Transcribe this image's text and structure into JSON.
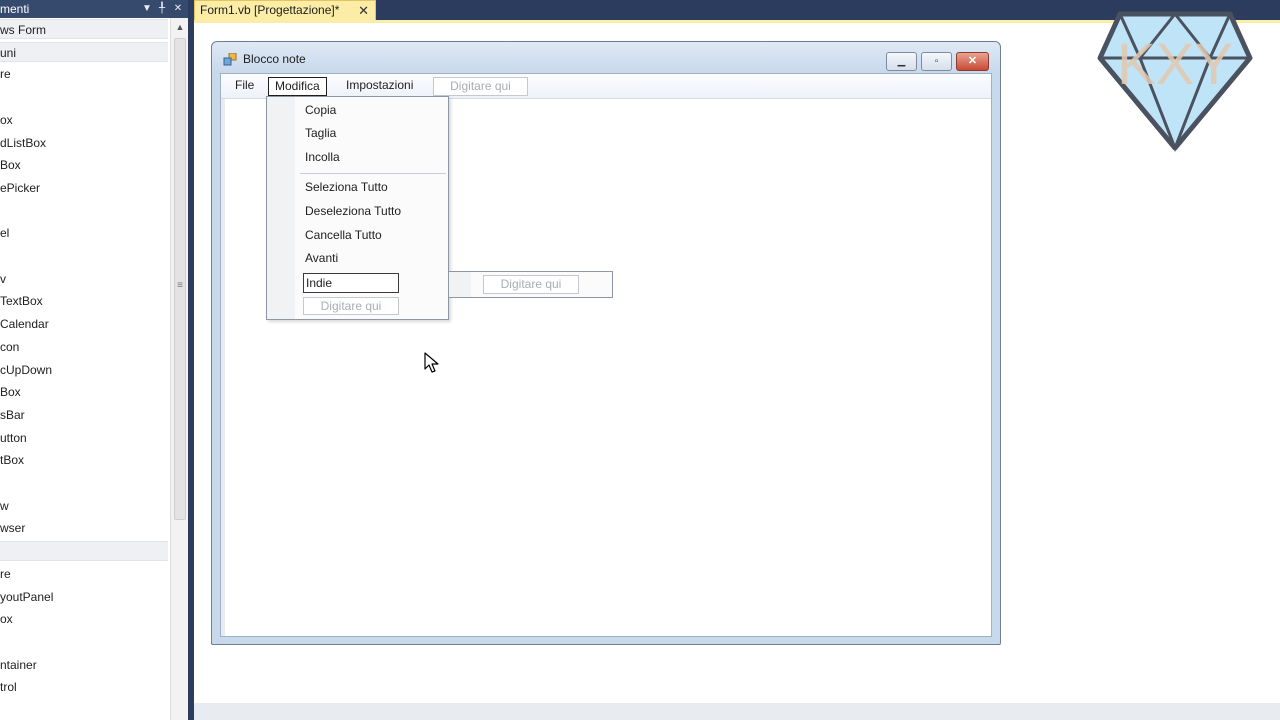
{
  "toolbox": {
    "header_title": "menti",
    "items": [
      {
        "label": "ws Form",
        "group": true
      },
      {
        "label": "uni",
        "group": true
      },
      {
        "label": "re",
        "group": false
      },
      {
        "label": "",
        "group": false
      },
      {
        "label": "ox",
        "group": false
      },
      {
        "label": "dListBox",
        "group": false
      },
      {
        "label": "Box",
        "group": false
      },
      {
        "label": "ePicker",
        "group": false
      },
      {
        "label": "",
        "group": false
      },
      {
        "label": "el",
        "group": false
      },
      {
        "label": "",
        "group": false
      },
      {
        "label": "v",
        "group": false
      },
      {
        "label": "TextBox",
        "group": false
      },
      {
        "label": "Calendar",
        "group": false
      },
      {
        "label": "con",
        "group": false
      },
      {
        "label": "cUpDown",
        "group": false
      },
      {
        "label": "Box",
        "group": false
      },
      {
        "label": "sBar",
        "group": false
      },
      {
        "label": "utton",
        "group": false
      },
      {
        "label": "tBox",
        "group": false
      },
      {
        "label": "",
        "group": false
      },
      {
        "label": "w",
        "group": false
      },
      {
        "label": "wser",
        "group": false
      },
      {
        "label": "",
        "group": true
      },
      {
        "label": "re",
        "group": false
      },
      {
        "label": "youtPanel",
        "group": false
      },
      {
        "label": "ox",
        "group": false
      },
      {
        "label": "",
        "group": false
      },
      {
        "label": "ntainer",
        "group": false
      },
      {
        "label": "trol",
        "group": false
      }
    ]
  },
  "tab": {
    "label": "Form1.vb [Progettazione]*",
    "close_glyph": "✕"
  },
  "form": {
    "title": "Blocco note",
    "menu": {
      "file": "File",
      "modifica": "Modifica",
      "impostazioni": "Impostazioni",
      "placeholder": "Digitare qui"
    },
    "dropdown": {
      "items": [
        "Copia",
        "Taglia",
        "Incolla",
        "Seleziona Tutto",
        "Deseleziona Tutto",
        "Cancella Tutto",
        "Avanti"
      ],
      "edit_value": "Indie",
      "placeholder": "Digitare qui"
    },
    "submenu": {
      "placeholder": "Digitare qui"
    }
  },
  "logo": {
    "text": "KXY",
    "fill": "#bfe3f7",
    "stroke": "#4a5260",
    "text_color": "#e3c9b0"
  }
}
